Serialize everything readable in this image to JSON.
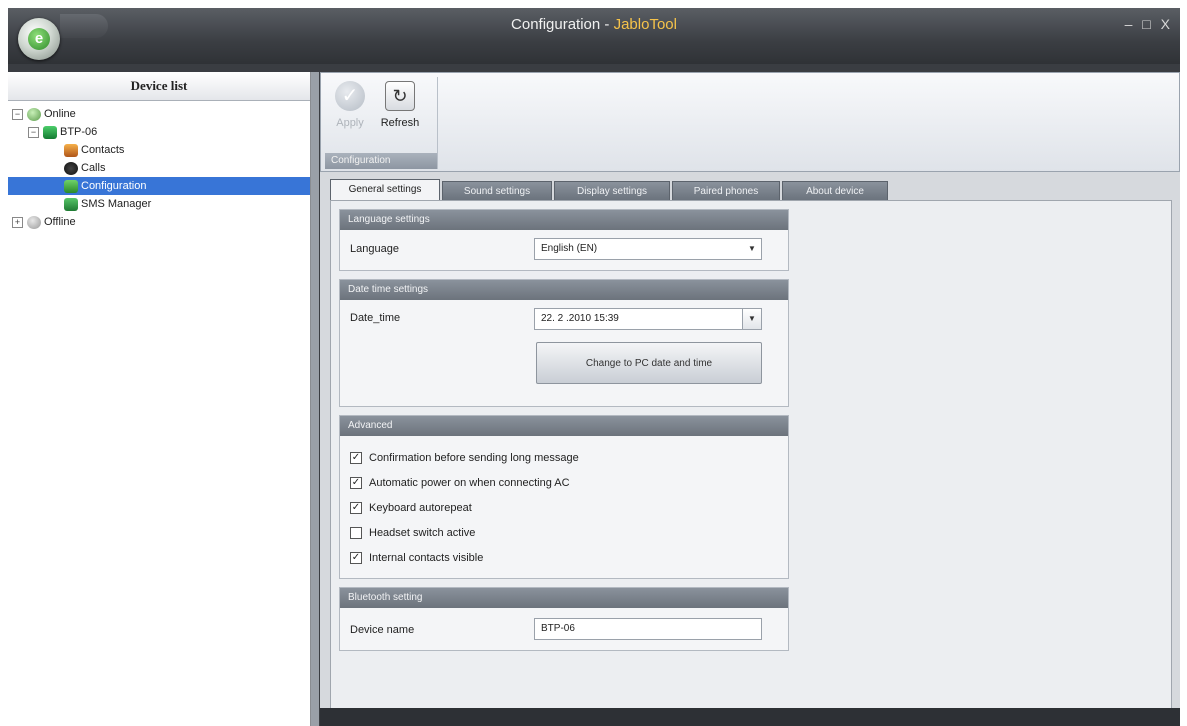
{
  "window": {
    "title_prefix": "Configuration - ",
    "app_name": "JabloTool",
    "controls": [
      "–",
      "□",
      "X"
    ]
  },
  "device_list": {
    "header": "Device list",
    "online": "Online",
    "device": "BTP-06",
    "items": [
      "Contacts",
      "Calls",
      "Configuration",
      "SMS Manager"
    ],
    "offline": "Offline",
    "selected": "Configuration"
  },
  "ribbon": {
    "apply": "Apply",
    "refresh": "Refresh",
    "group": "Configuration"
  },
  "tabs": [
    "General settings",
    "Sound settings",
    "Display settings",
    "Paired phones",
    "About device"
  ],
  "language_group": {
    "title": "Language settings",
    "label": "Language",
    "value": "English (EN)"
  },
  "datetime_group": {
    "title": "Date time settings",
    "label": "Date_time",
    "value": "22. 2 .2010 15:39",
    "button": "Change to PC date and time"
  },
  "advanced_group": {
    "title": "Advanced",
    "options": [
      {
        "label": "Confirmation before sending long message",
        "checked": true
      },
      {
        "label": "Automatic power on when connecting AC",
        "checked": true
      },
      {
        "label": "Keyboard autorepeat",
        "checked": true
      },
      {
        "label": "Headset switch active",
        "checked": false
      },
      {
        "label": "Internal contacts visible",
        "checked": true
      }
    ]
  },
  "bluetooth_group": {
    "title": "Bluetooth setting",
    "label": "Device name",
    "value": "BTP-06"
  },
  "colors": {
    "accent_title": "#f6c34a",
    "selection": "#3875d7",
    "chrome_dark": "#3a3d42"
  }
}
